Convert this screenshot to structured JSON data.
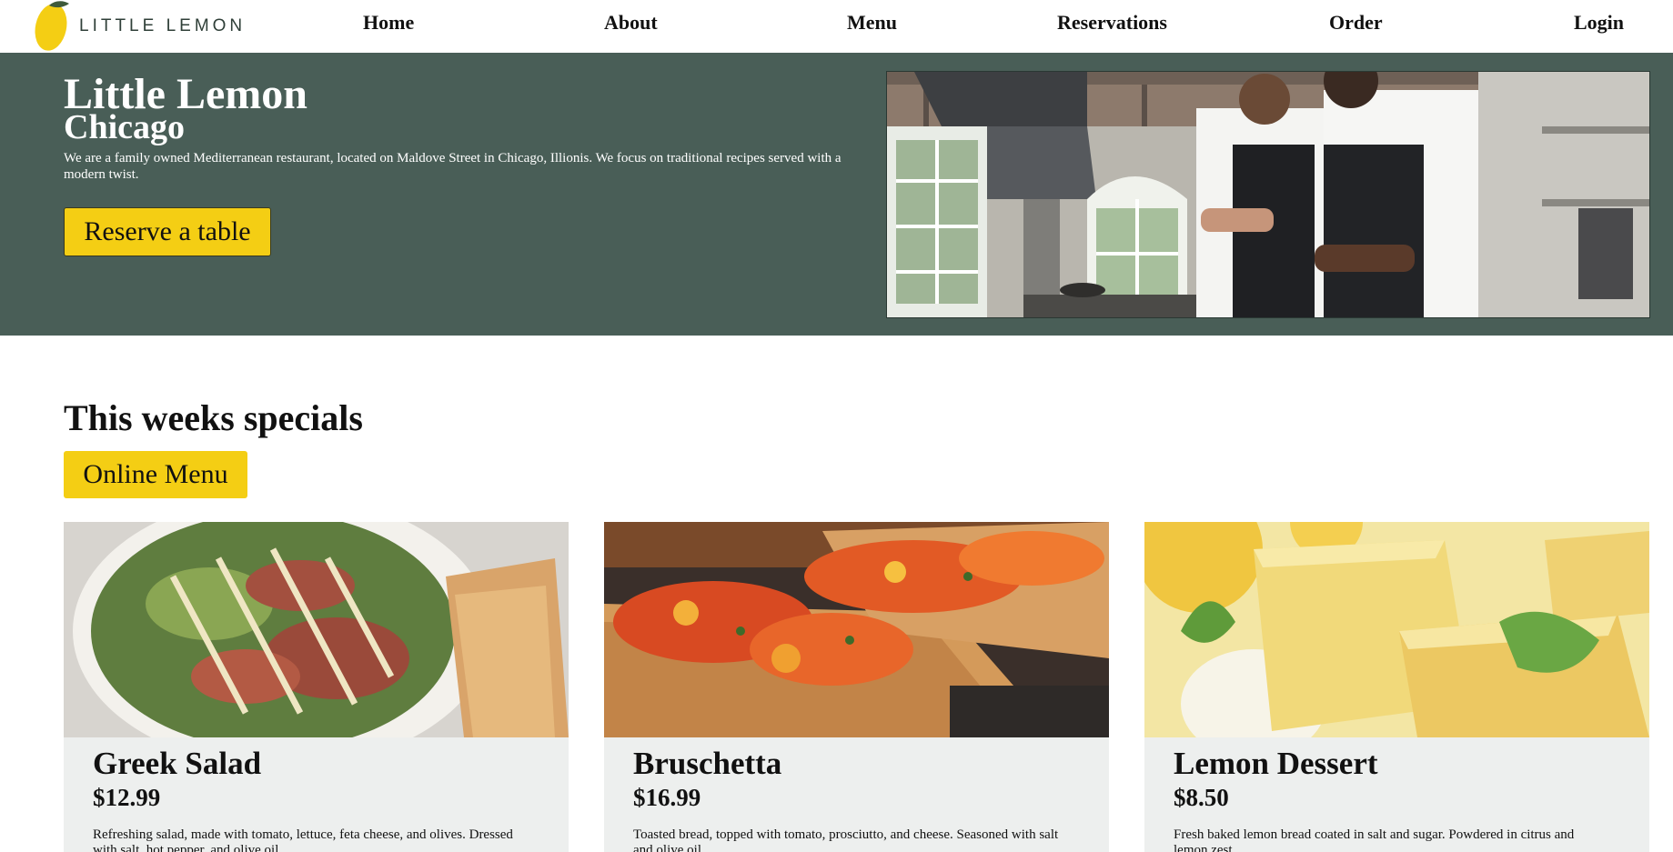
{
  "nav": {
    "brand": "LITTLE LEMON",
    "links": [
      "Home",
      "About",
      "Menu",
      "Reservations",
      "Order",
      "Login"
    ]
  },
  "hero": {
    "title": "Little Lemon",
    "subtitle": "Chicago",
    "description": "We are a family owned Mediterranean restaurant, located on Maldove Street in Chicago, Illionis. We focus on traditional recipes served with a modern twist.",
    "button": "Reserve a table"
  },
  "specials": {
    "title": "This weeks specials",
    "menu_button": "Online Menu",
    "items": [
      {
        "name": "Greek Salad",
        "price": "$12.99",
        "description": "Refreshing salad, made with tomato, lettuce, feta cheese, and olives. Dressed with salt, hot pepper, and olive oil."
      },
      {
        "name": "Bruschetta",
        "price": "$16.99",
        "description": "Toasted bread, topped with tomato, prosciutto, and cheese. Seasoned with salt and olive oil."
      },
      {
        "name": "Lemon Dessert",
        "price": "$8.50",
        "description": "Fresh baked lemon bread coated in salt and sugar. Powdered in citrus and lemon zest."
      }
    ]
  },
  "colors": {
    "primary_green": "#495e57",
    "primary_yellow": "#f4ce14",
    "card_background": "#edefee"
  }
}
